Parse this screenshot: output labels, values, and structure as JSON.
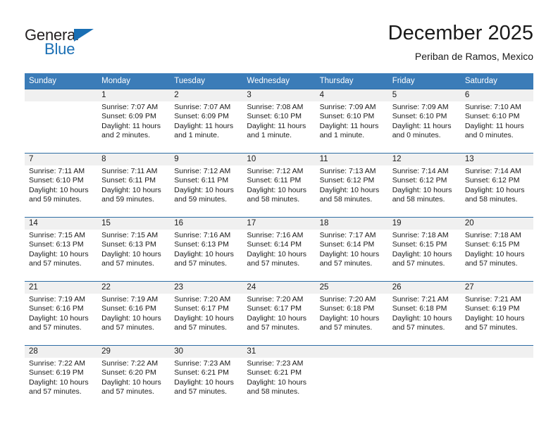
{
  "brand": {
    "name_top": "General",
    "name_bottom": "Blue"
  },
  "header": {
    "title": "December 2025",
    "location": "Periban de Ramos, Mexico"
  },
  "weekday_headers": [
    "Sunday",
    "Monday",
    "Tuesday",
    "Wednesday",
    "Thursday",
    "Friday",
    "Saturday"
  ],
  "colors": {
    "header_blue": "#3b7cb8",
    "row_divider_blue": "#2e6da4",
    "daynum_band": "#f0f0f0",
    "logo_blue": "#1a6fb4",
    "text": "#1a1a1a"
  },
  "weeks": [
    [
      {
        "day": "",
        "sunrise": "",
        "sunset": "",
        "daylight_1": "",
        "daylight_2": ""
      },
      {
        "day": "1",
        "sunrise": "Sunrise: 7:07 AM",
        "sunset": "Sunset: 6:09 PM",
        "daylight_1": "Daylight: 11 hours",
        "daylight_2": "and 2 minutes."
      },
      {
        "day": "2",
        "sunrise": "Sunrise: 7:07 AM",
        "sunset": "Sunset: 6:09 PM",
        "daylight_1": "Daylight: 11 hours",
        "daylight_2": "and 1 minute."
      },
      {
        "day": "3",
        "sunrise": "Sunrise: 7:08 AM",
        "sunset": "Sunset: 6:10 PM",
        "daylight_1": "Daylight: 11 hours",
        "daylight_2": "and 1 minute."
      },
      {
        "day": "4",
        "sunrise": "Sunrise: 7:09 AM",
        "sunset": "Sunset: 6:10 PM",
        "daylight_1": "Daylight: 11 hours",
        "daylight_2": "and 1 minute."
      },
      {
        "day": "5",
        "sunrise": "Sunrise: 7:09 AM",
        "sunset": "Sunset: 6:10 PM",
        "daylight_1": "Daylight: 11 hours",
        "daylight_2": "and 0 minutes."
      },
      {
        "day": "6",
        "sunrise": "Sunrise: 7:10 AM",
        "sunset": "Sunset: 6:10 PM",
        "daylight_1": "Daylight: 11 hours",
        "daylight_2": "and 0 minutes."
      }
    ],
    [
      {
        "day": "7",
        "sunrise": "Sunrise: 7:11 AM",
        "sunset": "Sunset: 6:10 PM",
        "daylight_1": "Daylight: 10 hours",
        "daylight_2": "and 59 minutes."
      },
      {
        "day": "8",
        "sunrise": "Sunrise: 7:11 AM",
        "sunset": "Sunset: 6:11 PM",
        "daylight_1": "Daylight: 10 hours",
        "daylight_2": "and 59 minutes."
      },
      {
        "day": "9",
        "sunrise": "Sunrise: 7:12 AM",
        "sunset": "Sunset: 6:11 PM",
        "daylight_1": "Daylight: 10 hours",
        "daylight_2": "and 59 minutes."
      },
      {
        "day": "10",
        "sunrise": "Sunrise: 7:12 AM",
        "sunset": "Sunset: 6:11 PM",
        "daylight_1": "Daylight: 10 hours",
        "daylight_2": "and 58 minutes."
      },
      {
        "day": "11",
        "sunrise": "Sunrise: 7:13 AM",
        "sunset": "Sunset: 6:12 PM",
        "daylight_1": "Daylight: 10 hours",
        "daylight_2": "and 58 minutes."
      },
      {
        "day": "12",
        "sunrise": "Sunrise: 7:14 AM",
        "sunset": "Sunset: 6:12 PM",
        "daylight_1": "Daylight: 10 hours",
        "daylight_2": "and 58 minutes."
      },
      {
        "day": "13",
        "sunrise": "Sunrise: 7:14 AM",
        "sunset": "Sunset: 6:12 PM",
        "daylight_1": "Daylight: 10 hours",
        "daylight_2": "and 58 minutes."
      }
    ],
    [
      {
        "day": "14",
        "sunrise": "Sunrise: 7:15 AM",
        "sunset": "Sunset: 6:13 PM",
        "daylight_1": "Daylight: 10 hours",
        "daylight_2": "and 57 minutes."
      },
      {
        "day": "15",
        "sunrise": "Sunrise: 7:15 AM",
        "sunset": "Sunset: 6:13 PM",
        "daylight_1": "Daylight: 10 hours",
        "daylight_2": "and 57 minutes."
      },
      {
        "day": "16",
        "sunrise": "Sunrise: 7:16 AM",
        "sunset": "Sunset: 6:13 PM",
        "daylight_1": "Daylight: 10 hours",
        "daylight_2": "and 57 minutes."
      },
      {
        "day": "17",
        "sunrise": "Sunrise: 7:16 AM",
        "sunset": "Sunset: 6:14 PM",
        "daylight_1": "Daylight: 10 hours",
        "daylight_2": "and 57 minutes."
      },
      {
        "day": "18",
        "sunrise": "Sunrise: 7:17 AM",
        "sunset": "Sunset: 6:14 PM",
        "daylight_1": "Daylight: 10 hours",
        "daylight_2": "and 57 minutes."
      },
      {
        "day": "19",
        "sunrise": "Sunrise: 7:18 AM",
        "sunset": "Sunset: 6:15 PM",
        "daylight_1": "Daylight: 10 hours",
        "daylight_2": "and 57 minutes."
      },
      {
        "day": "20",
        "sunrise": "Sunrise: 7:18 AM",
        "sunset": "Sunset: 6:15 PM",
        "daylight_1": "Daylight: 10 hours",
        "daylight_2": "and 57 minutes."
      }
    ],
    [
      {
        "day": "21",
        "sunrise": "Sunrise: 7:19 AM",
        "sunset": "Sunset: 6:16 PM",
        "daylight_1": "Daylight: 10 hours",
        "daylight_2": "and 57 minutes."
      },
      {
        "day": "22",
        "sunrise": "Sunrise: 7:19 AM",
        "sunset": "Sunset: 6:16 PM",
        "daylight_1": "Daylight: 10 hours",
        "daylight_2": "and 57 minutes."
      },
      {
        "day": "23",
        "sunrise": "Sunrise: 7:20 AM",
        "sunset": "Sunset: 6:17 PM",
        "daylight_1": "Daylight: 10 hours",
        "daylight_2": "and 57 minutes."
      },
      {
        "day": "24",
        "sunrise": "Sunrise: 7:20 AM",
        "sunset": "Sunset: 6:17 PM",
        "daylight_1": "Daylight: 10 hours",
        "daylight_2": "and 57 minutes."
      },
      {
        "day": "25",
        "sunrise": "Sunrise: 7:20 AM",
        "sunset": "Sunset: 6:18 PM",
        "daylight_1": "Daylight: 10 hours",
        "daylight_2": "and 57 minutes."
      },
      {
        "day": "26",
        "sunrise": "Sunrise: 7:21 AM",
        "sunset": "Sunset: 6:18 PM",
        "daylight_1": "Daylight: 10 hours",
        "daylight_2": "and 57 minutes."
      },
      {
        "day": "27",
        "sunrise": "Sunrise: 7:21 AM",
        "sunset": "Sunset: 6:19 PM",
        "daylight_1": "Daylight: 10 hours",
        "daylight_2": "and 57 minutes."
      }
    ],
    [
      {
        "day": "28",
        "sunrise": "Sunrise: 7:22 AM",
        "sunset": "Sunset: 6:19 PM",
        "daylight_1": "Daylight: 10 hours",
        "daylight_2": "and 57 minutes."
      },
      {
        "day": "29",
        "sunrise": "Sunrise: 7:22 AM",
        "sunset": "Sunset: 6:20 PM",
        "daylight_1": "Daylight: 10 hours",
        "daylight_2": "and 57 minutes."
      },
      {
        "day": "30",
        "sunrise": "Sunrise: 7:23 AM",
        "sunset": "Sunset: 6:21 PM",
        "daylight_1": "Daylight: 10 hours",
        "daylight_2": "and 57 minutes."
      },
      {
        "day": "31",
        "sunrise": "Sunrise: 7:23 AM",
        "sunset": "Sunset: 6:21 PM",
        "daylight_1": "Daylight: 10 hours",
        "daylight_2": "and 58 minutes."
      },
      {
        "day": "",
        "sunrise": "",
        "sunset": "",
        "daylight_1": "",
        "daylight_2": ""
      },
      {
        "day": "",
        "sunrise": "",
        "sunset": "",
        "daylight_1": "",
        "daylight_2": ""
      },
      {
        "day": "",
        "sunrise": "",
        "sunset": "",
        "daylight_1": "",
        "daylight_2": ""
      }
    ]
  ]
}
